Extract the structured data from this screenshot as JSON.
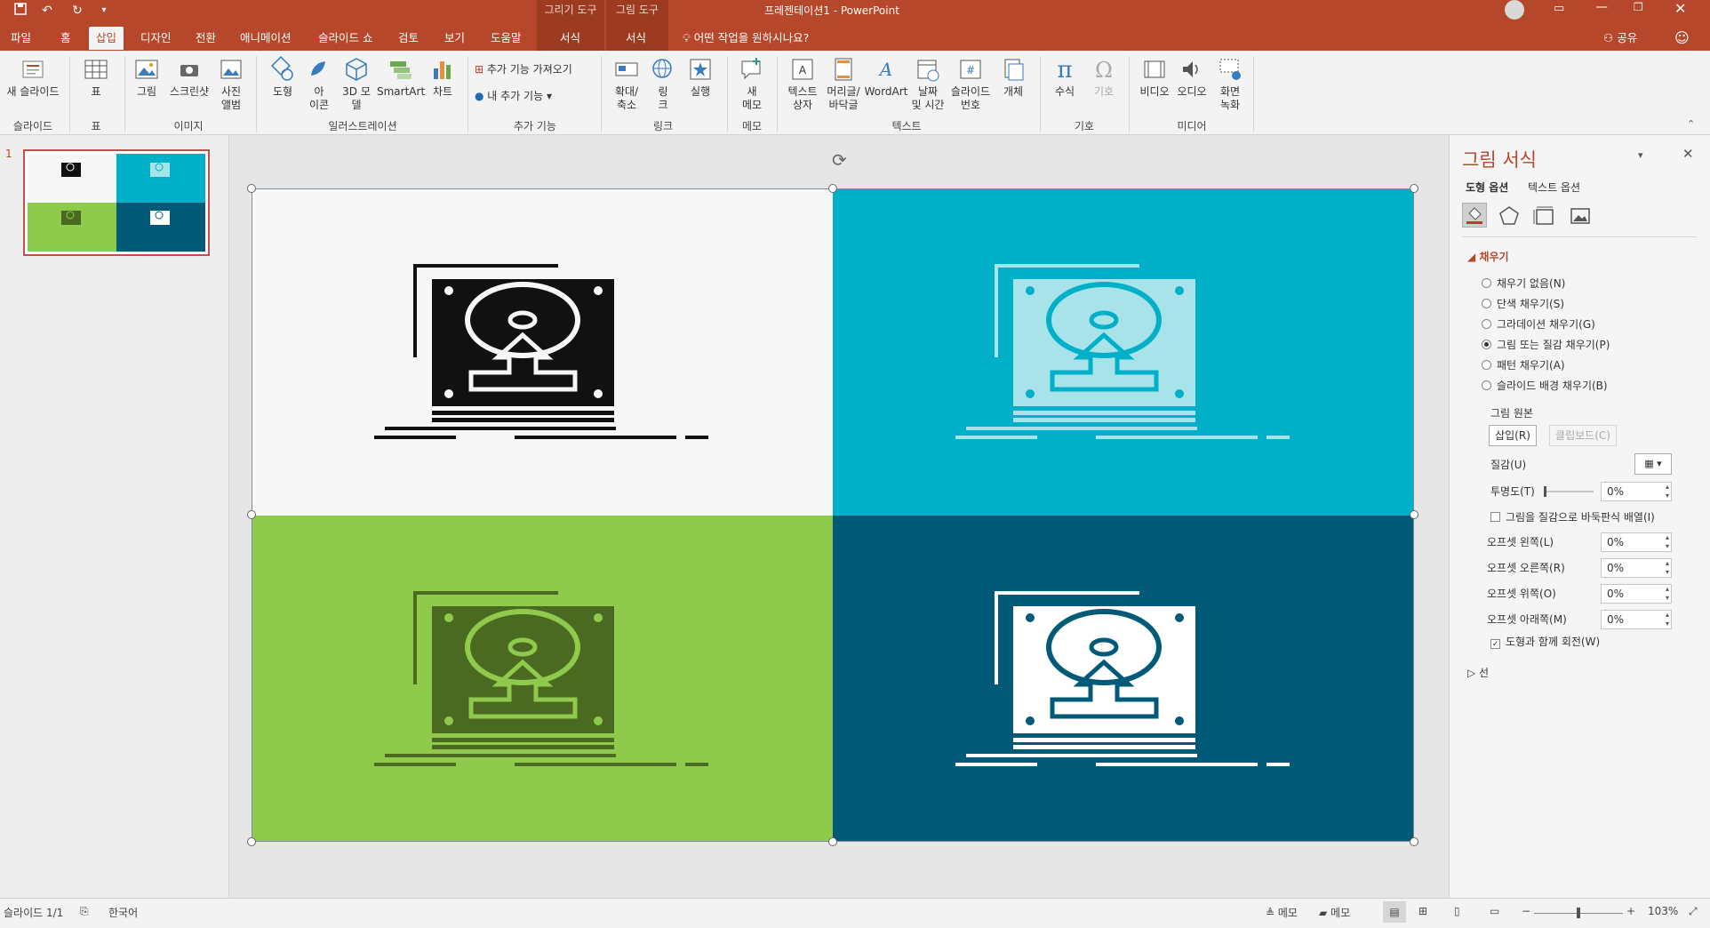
{
  "titlebar": {
    "title": "프레젠테이션1  -  PowerPoint",
    "context_drawing": "그리기 도구",
    "context_picture": "그림 도구",
    "share": "공유",
    "tell_me": "어떤 작업을 원하시나요?"
  },
  "tabs": {
    "file": "파일",
    "home": "홈",
    "insert": "삽입",
    "design": "디자인",
    "transitions": "전환",
    "animations": "애니메이션",
    "slideshow": "슬라이드 쇼",
    "review": "검토",
    "view": "보기",
    "help": "도움말",
    "format_drawing": "서식",
    "format_picture": "서식"
  },
  "ribbon": {
    "new_slide": "새 슬라이드",
    "table": "표",
    "pictures": "그림",
    "screenshot": "스크린샷",
    "photo_album_1": "사진",
    "photo_album_2": "앨범",
    "shapes": "도형",
    "icons_1": "아",
    "icons_2": "이콘",
    "model3d_1": "3D 모",
    "model3d_2": "델",
    "smartart": "SmartArt",
    "chart": "차트",
    "get_addins": "추가 기능 가져오기",
    "my_addins": "내 추가 기능",
    "zoom_1": "확대/",
    "zoom_2": "축소",
    "link_1": "링",
    "link_2": "크",
    "action": "실행",
    "comment_1": "새",
    "comment_2": "메모",
    "textbox_1": "텍스트",
    "textbox_2": "상자",
    "header_1": "머리글/",
    "header_2": "바닥글",
    "wordart": "WordArt",
    "datetime_1": "날짜",
    "datetime_2": "및 시간",
    "slidenum_1": "슬라이드",
    "slidenum_2": "번호",
    "object": "개체",
    "equation": "수식",
    "symbol": "기호",
    "video": "비디오",
    "audio": "오디오",
    "screenrec_1": "화면",
    "screenrec_2": "녹화",
    "groups": {
      "slides": "슬라이드",
      "tables": "표",
      "images": "이미지",
      "illustrations": "일러스트레이션",
      "addins": "추가 기능",
      "links": "링크",
      "comments": "메모",
      "text": "텍스트",
      "symbols": "기호",
      "media": "미디어"
    }
  },
  "thumbnails": {
    "slide_number": "1"
  },
  "panel": {
    "title": "그림 서식",
    "tab_shape": "도형 옵션",
    "tab_text": "텍스트 옵션",
    "section_fill": "채우기",
    "fill_options": [
      {
        "label": "채우기 없음(N)",
        "selected": false
      },
      {
        "label": "단색 채우기(S)",
        "selected": false
      },
      {
        "label": "그라데이션 채우기(G)",
        "selected": false
      },
      {
        "label": "그림 또는 질감 채우기(P)",
        "selected": true
      },
      {
        "label": "패턴 채우기(A)",
        "selected": false
      },
      {
        "label": "슬라이드 배경 채우기(B)",
        "selected": false
      }
    ],
    "picture_source": "그림 원본",
    "insert_btn": "삽입(R)",
    "clipboard_btn": "클립보드(C)",
    "texture": "질감(U)",
    "transparency": "투명도(T)",
    "transparency_value": "0%",
    "tile_checkbox": "그림을 질감으로 바둑판식 배열(I)",
    "offset_left": "오프셋 왼쪽(L)",
    "offset_left_value": "0%",
    "offset_right": "오프셋 오른쪽(R)",
    "offset_right_value": "0%",
    "offset_top": "오프셋 위쪽(O)",
    "offset_top_value": "0%",
    "offset_bottom": "오프셋 아래쪽(M)",
    "offset_bottom_value": "0%",
    "rotate_checkbox": "도형과 함께 회전(W)",
    "section_line": "선"
  },
  "statusbar": {
    "slide_info": "슬라이드 1/1",
    "language": "한국어",
    "notes": "메모",
    "comments": "메모",
    "zoom": "103%"
  },
  "slide_colors": {
    "q1": "#f7f7f7",
    "q2": "#00b0c8",
    "q3": "#8fca4c",
    "q4": "#005a78"
  }
}
